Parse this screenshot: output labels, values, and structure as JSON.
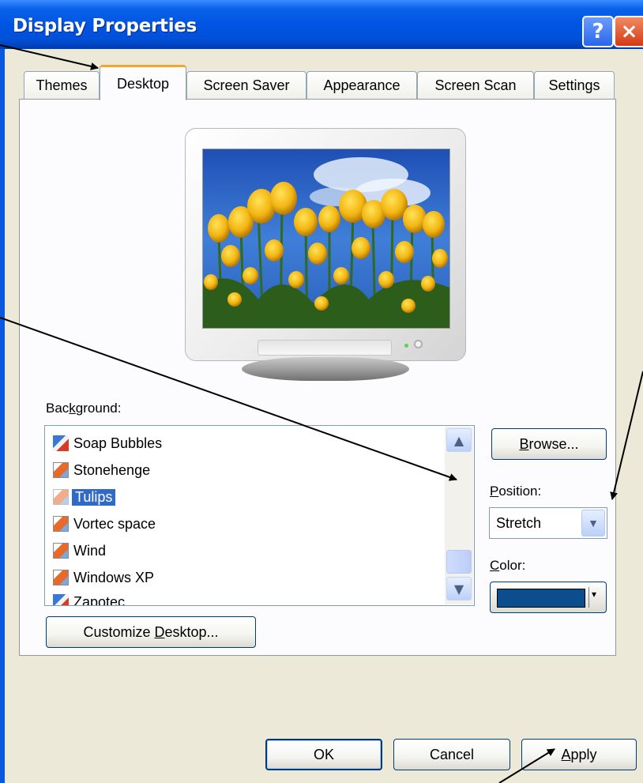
{
  "window": {
    "title": "Display Properties",
    "help_label": "?",
    "close_label": "×"
  },
  "tabs": [
    {
      "label": "Themes"
    },
    {
      "label": "Desktop",
      "active": true
    },
    {
      "label": "Screen Saver"
    },
    {
      "label": "Appearance"
    },
    {
      "label": "Screen Scan"
    },
    {
      "label": "Settings"
    }
  ],
  "background": {
    "label_pre": "Bac",
    "label_key": "k",
    "label_post": "ground:",
    "items": [
      {
        "label": "Soap Bubbles",
        "icon": "brush-image-icon"
      },
      {
        "label": "Stonehenge",
        "icon": "image-file-icon"
      },
      {
        "label": "Tulips",
        "icon": "image-file-icon",
        "selected": true
      },
      {
        "label": "Vortec space",
        "icon": "image-file-icon"
      },
      {
        "label": "Wind",
        "icon": "image-file-icon"
      },
      {
        "label": "Windows XP",
        "icon": "image-file-icon"
      },
      {
        "label": "Zapotec",
        "icon": "brush-image-icon"
      }
    ],
    "scroll_up": "▲",
    "scroll_down": "▼"
  },
  "browse": {
    "pre": "",
    "key": "B",
    "post": "rowse..."
  },
  "position": {
    "label_key": "P",
    "label_post": "osition:",
    "value": "Stretch",
    "dropdown_glyph": "▼"
  },
  "color": {
    "label_key": "C",
    "label_post": "olor:",
    "value": "#0c4d8e",
    "arrow": "▾"
  },
  "customize": {
    "pre": "Customize ",
    "key": "D",
    "post": "esktop..."
  },
  "footer": {
    "ok": "OK",
    "cancel": "Cancel",
    "apply_key": "A",
    "apply_post": "pply"
  },
  "colors": {
    "titlebar": "#0054e3",
    "selection": "#316ac5",
    "dialog_bg": "#ece9d8",
    "active_tab_highlight": "#f5a623"
  }
}
